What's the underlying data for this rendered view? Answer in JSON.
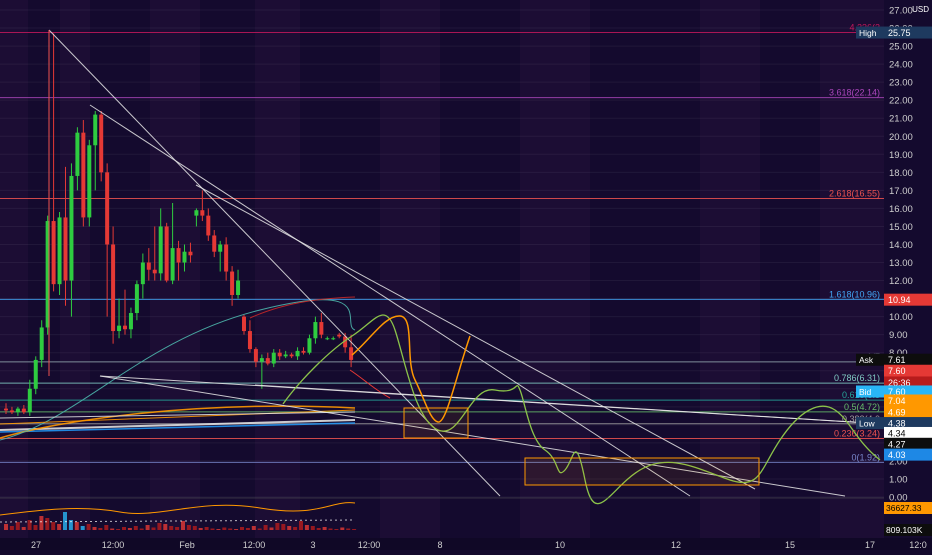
{
  "chart_data": {
    "type": "candlestick",
    "currency": "USD",
    "yaxis": {
      "min": 0,
      "max": 27,
      "ticks": [
        "0.00",
        "1.00",
        "2.00",
        "3.00",
        "4.00",
        "5.00",
        "6.00",
        "7.00",
        "8.00",
        "9.00",
        "10.00",
        "11.00",
        "12.00",
        "13.00",
        "14.00",
        "15.00",
        "16.00",
        "17.00",
        "18.00",
        "19.00",
        "20.00",
        "21.00",
        "22.00",
        "23.00",
        "24.00",
        "25.00",
        "26.00",
        "27.00"
      ],
      "scale": "linear"
    },
    "xaxis": {
      "tick_labels": [
        "27",
        "12:00",
        "Feb",
        "12:00",
        "3",
        "12:00",
        "8",
        "10",
        "12",
        "15",
        "17",
        "12:0"
      ]
    },
    "candles": [
      {
        "o": 4.9,
        "h": 5.2,
        "l": 4.6,
        "c": 4.8
      },
      {
        "o": 4.8,
        "h": 5.0,
        "l": 4.6,
        "c": 4.7
      },
      {
        "o": 4.7,
        "h": 5.0,
        "l": 4.5,
        "c": 4.9
      },
      {
        "o": 4.9,
        "h": 5.1,
        "l": 4.6,
        "c": 4.7
      },
      {
        "o": 4.7,
        "h": 6.5,
        "l": 4.5,
        "c": 6.0
      },
      {
        "o": 6.0,
        "h": 7.8,
        "l": 5.7,
        "c": 7.6
      },
      {
        "o": 7.6,
        "h": 9.8,
        "l": 7.2,
        "c": 9.4
      },
      {
        "o": 9.4,
        "h": 15.6,
        "l": 9.0,
        "c": 15.3
      },
      {
        "o": 15.3,
        "h": 25.7,
        "l": 11.4,
        "c": 11.8
      },
      {
        "o": 11.8,
        "h": 15.8,
        "l": 11.2,
        "c": 15.5
      },
      {
        "o": 15.5,
        "h": 18.3,
        "l": 10.6,
        "c": 12.0
      },
      {
        "o": 12.0,
        "h": 18.5,
        "l": 10.0,
        "c": 17.8
      },
      {
        "o": 17.8,
        "h": 20.5,
        "l": 17.0,
        "c": 20.2
      },
      {
        "o": 20.2,
        "h": 20.9,
        "l": 15.0,
        "c": 15.5
      },
      {
        "o": 15.5,
        "h": 19.8,
        "l": 15.0,
        "c": 19.5
      },
      {
        "o": 19.5,
        "h": 21.4,
        "l": 17.0,
        "c": 21.2
      },
      {
        "o": 21.2,
        "h": 21.4,
        "l": 17.5,
        "c": 18.0
      },
      {
        "o": 18.0,
        "h": 18.5,
        "l": 10.0,
        "c": 14.0
      },
      {
        "o": 14.0,
        "h": 15.0,
        "l": 8.5,
        "c": 9.2
      },
      {
        "o": 9.2,
        "h": 11.0,
        "l": 8.8,
        "c": 9.5
      },
      {
        "o": 9.5,
        "h": 11.5,
        "l": 9.0,
        "c": 9.3
      },
      {
        "o": 9.3,
        "h": 10.5,
        "l": 8.8,
        "c": 10.2
      },
      {
        "o": 10.2,
        "h": 12.0,
        "l": 9.8,
        "c": 11.8
      },
      {
        "o": 11.8,
        "h": 13.5,
        "l": 11.0,
        "c": 13.0
      },
      {
        "o": 13.0,
        "h": 13.8,
        "l": 12.0,
        "c": 12.6
      },
      {
        "o": 12.6,
        "h": 15.0,
        "l": 12.0,
        "c": 12.4
      },
      {
        "o": 12.4,
        "h": 16.0,
        "l": 12.0,
        "c": 15.0
      },
      {
        "o": 15.0,
        "h": 15.2,
        "l": 11.9,
        "c": 12.0
      },
      {
        "o": 12.0,
        "h": 16.3,
        "l": 11.8,
        "c": 13.8
      },
      {
        "o": 13.8,
        "h": 14.2,
        "l": 12.0,
        "c": 13.0
      },
      {
        "o": 13.0,
        "h": 14.0,
        "l": 12.5,
        "c": 13.6
      },
      {
        "o": 13.6,
        "h": 14.1,
        "l": 13.0,
        "c": 13.4
      },
      {
        "o": 15.6,
        "h": 16.0,
        "l": 15.0,
        "c": 15.9
      },
      {
        "o": 15.9,
        "h": 17.0,
        "l": 15.3,
        "c": 15.6
      },
      {
        "o": 15.6,
        "h": 16.0,
        "l": 14.2,
        "c": 14.5
      },
      {
        "o": 14.5,
        "h": 14.8,
        "l": 13.3,
        "c": 13.6
      },
      {
        "o": 13.6,
        "h": 14.2,
        "l": 12.5,
        "c": 14.0
      },
      {
        "o": 14.0,
        "h": 14.4,
        "l": 12.0,
        "c": 12.5
      },
      {
        "o": 12.5,
        "h": 12.8,
        "l": 10.6,
        "c": 11.2
      },
      {
        "o": 11.2,
        "h": 12.6,
        "l": 11.0,
        "c": 12.0
      },
      {
        "o": 10.0,
        "h": 10.1,
        "l": 9.0,
        "c": 9.2
      },
      {
        "o": 9.2,
        "h": 9.8,
        "l": 8.0,
        "c": 8.2
      },
      {
        "o": 8.2,
        "h": 8.3,
        "l": 7.2,
        "c": 7.5
      },
      {
        "o": 7.5,
        "h": 7.9,
        "l": 6.0,
        "c": 7.7
      },
      {
        "o": 7.7,
        "h": 8.0,
        "l": 7.3,
        "c": 7.4
      },
      {
        "o": 7.4,
        "h": 8.2,
        "l": 7.2,
        "c": 8.0
      },
      {
        "o": 8.0,
        "h": 8.2,
        "l": 7.6,
        "c": 7.8
      },
      {
        "o": 7.8,
        "h": 8.1,
        "l": 7.7,
        "c": 7.9
      },
      {
        "o": 7.9,
        "h": 8.0,
        "l": 7.7,
        "c": 7.8
      },
      {
        "o": 7.8,
        "h": 8.3,
        "l": 7.6,
        "c": 8.1
      },
      {
        "o": 8.1,
        "h": 8.3,
        "l": 7.9,
        "c": 8.0
      },
      {
        "o": 8.0,
        "h": 9.0,
        "l": 7.9,
        "c": 8.8
      },
      {
        "o": 8.8,
        "h": 10.0,
        "l": 8.5,
        "c": 9.7
      },
      {
        "o": 9.7,
        "h": 10.2,
        "l": 8.8,
        "c": 9.0
      },
      {
        "o": 8.8,
        "h": 8.9,
        "l": 8.7,
        "c": 8.8
      },
      {
        "o": 8.8,
        "h": 8.9,
        "l": 8.7,
        "c": 8.8
      },
      {
        "o": 9.0,
        "h": 9.1,
        "l": 8.8,
        "c": 8.9
      },
      {
        "o": 8.9,
        "h": 9.1,
        "l": 8.0,
        "c": 8.3
      },
      {
        "o": 8.3,
        "h": 9.0,
        "l": 7.2,
        "c": 7.6
      }
    ],
    "levels": [
      {
        "label": "4.236(2",
        "value": 25.75,
        "color": "#c2185b"
      },
      {
        "label": "3.618(22.14)",
        "value": 22.14,
        "color": "#ab47bc"
      },
      {
        "label": "2.618(16.55)",
        "value": 16.55,
        "color": "#ef5350"
      },
      {
        "label": "1.618(10.96)",
        "value": 10.96,
        "color": "#42a5f5"
      },
      {
        "label": "1(7",
        "value": 7.49,
        "color": "#90a4ae"
      },
      {
        "label": "0.786(6.31)",
        "value": 6.31,
        "color": "#80cbc4"
      },
      {
        "label": "0.618(5.3",
        "value": 5.37,
        "color": "#26a69a"
      },
      {
        "label": "0.5(4.72)",
        "value": 4.72,
        "color": "#66bb6a"
      },
      {
        "label": "0.382(4.0",
        "value": 4.06,
        "color": "#9e9e9e"
      },
      {
        "label": "0.236(3.24)",
        "value": 3.24,
        "color": "#ef5350"
      },
      {
        "label": "0(1.92)",
        "value": 1.92,
        "color": "#7986cb"
      }
    ],
    "price_labels": [
      {
        "text": "High",
        "value": "25.75",
        "y": 25.75,
        "bg": "#1e3a5f",
        "fg": "#ffffff"
      },
      {
        "text": "",
        "value": "10.94",
        "y": 10.94,
        "bg": "#e53935",
        "fg": "#ffffff"
      },
      {
        "text": "Ask",
        "value": "7.61",
        "y": 7.61,
        "bg": "#0d0d0d",
        "fg": "#ffffff"
      },
      {
        "text": "",
        "value": "7.60",
        "y": 7.0,
        "bg": "#e53935",
        "fg": "#ffffff"
      },
      {
        "text": "",
        "value": "26:36",
        "y": 6.35,
        "bg": "#b71c1c",
        "fg": "#ffffff"
      },
      {
        "text": "Bid",
        "value": "7.60",
        "y": 5.85,
        "bg": "#29b6f6",
        "fg": "#ffffff"
      },
      {
        "text": "",
        "value": "7.04",
        "y": 5.35,
        "bg": "#ff9800",
        "fg": "#ffffff"
      },
      {
        "text": "",
        "value": "4.69",
        "y": 4.72,
        "bg": "#ff9800",
        "fg": "#ffffff"
      },
      {
        "text": "Low",
        "value": "4.38",
        "y": 4.1,
        "bg": "#1e3a5f",
        "fg": "#ffffff"
      },
      {
        "text": "",
        "value": "4.34",
        "y": 3.55,
        "bg": "#ffffff",
        "fg": "#000000"
      },
      {
        "text": "",
        "value": "4.27",
        "y": 2.95,
        "bg": "#0d0d0d",
        "fg": "#ffffff"
      },
      {
        "text": "",
        "value": "4.03",
        "y": 2.35,
        "bg": "#1e88e5",
        "fg": "#ffffff"
      }
    ],
    "volume_pane": {
      "labels": [
        {
          "value": "36627.33",
          "bg": "#ff9800",
          "fg": "#000000"
        },
        {
          "value": "809.103K",
          "bg": "#0d0d0d",
          "fg": "#ffffff"
        }
      ]
    },
    "grid": true
  },
  "colors": {
    "background": "#140a2e",
    "up": "#2ecc40",
    "down": "#e53935",
    "axis_text": "#d0d0d0",
    "trendline": "#e8e8e8",
    "projection_green": "#8bc34a",
    "projection_orange": "#ff9800",
    "box": "#ff9800"
  }
}
